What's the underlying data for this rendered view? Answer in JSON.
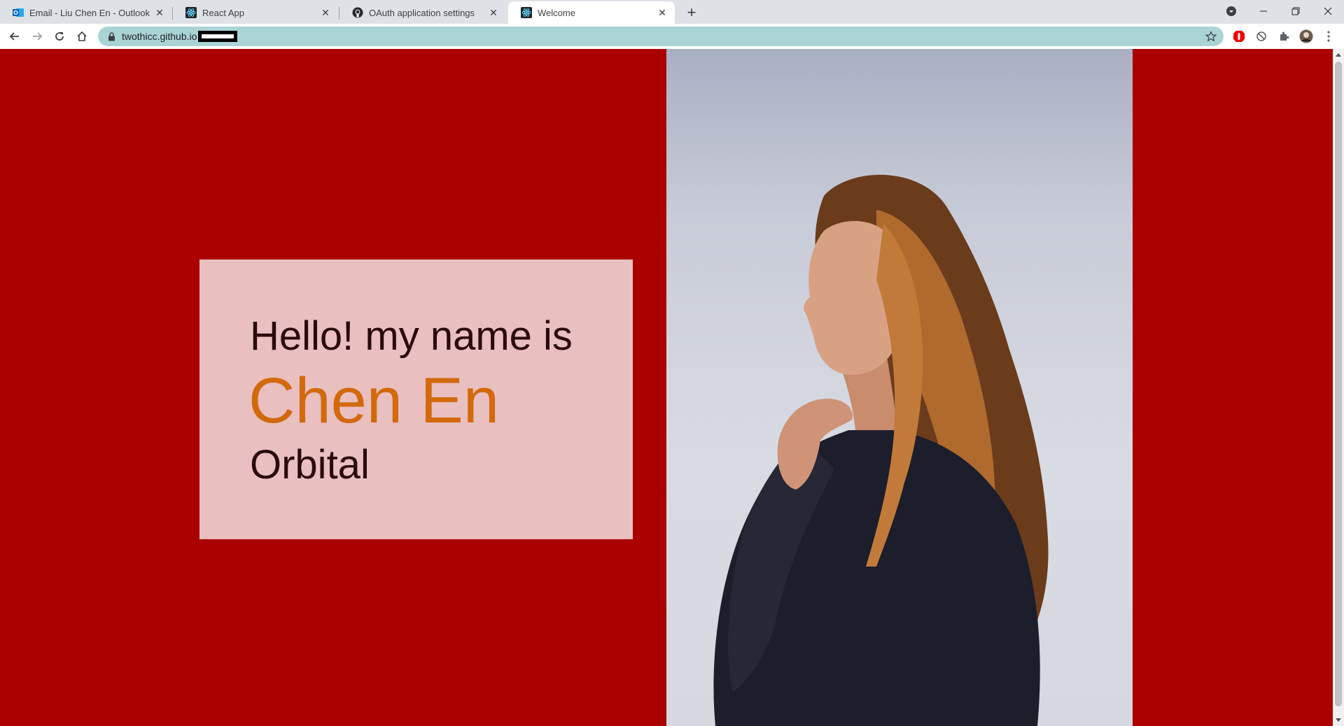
{
  "browser": {
    "tabs": [
      {
        "title": "Email - Liu Chen En - Outlook",
        "icon": "outlook-icon",
        "active": false
      },
      {
        "title": "React App",
        "icon": "react-icon",
        "active": false
      },
      {
        "title": "OAuth application settings",
        "icon": "github-icon",
        "active": false
      },
      {
        "title": "Welcome",
        "icon": "react-icon",
        "active": true
      }
    ],
    "new_tab_label": "+",
    "url": "twothicc.github.io"
  },
  "page": {
    "greeting": "Hello! my name is",
    "name": "Chen En",
    "subtitle": "Orbital",
    "colors": {
      "background": "#ab0000",
      "card": "#e9bfc0",
      "name": "#d2690b",
      "text": "#2a0a0a"
    },
    "photo_description_icon": "portrait-photo"
  }
}
